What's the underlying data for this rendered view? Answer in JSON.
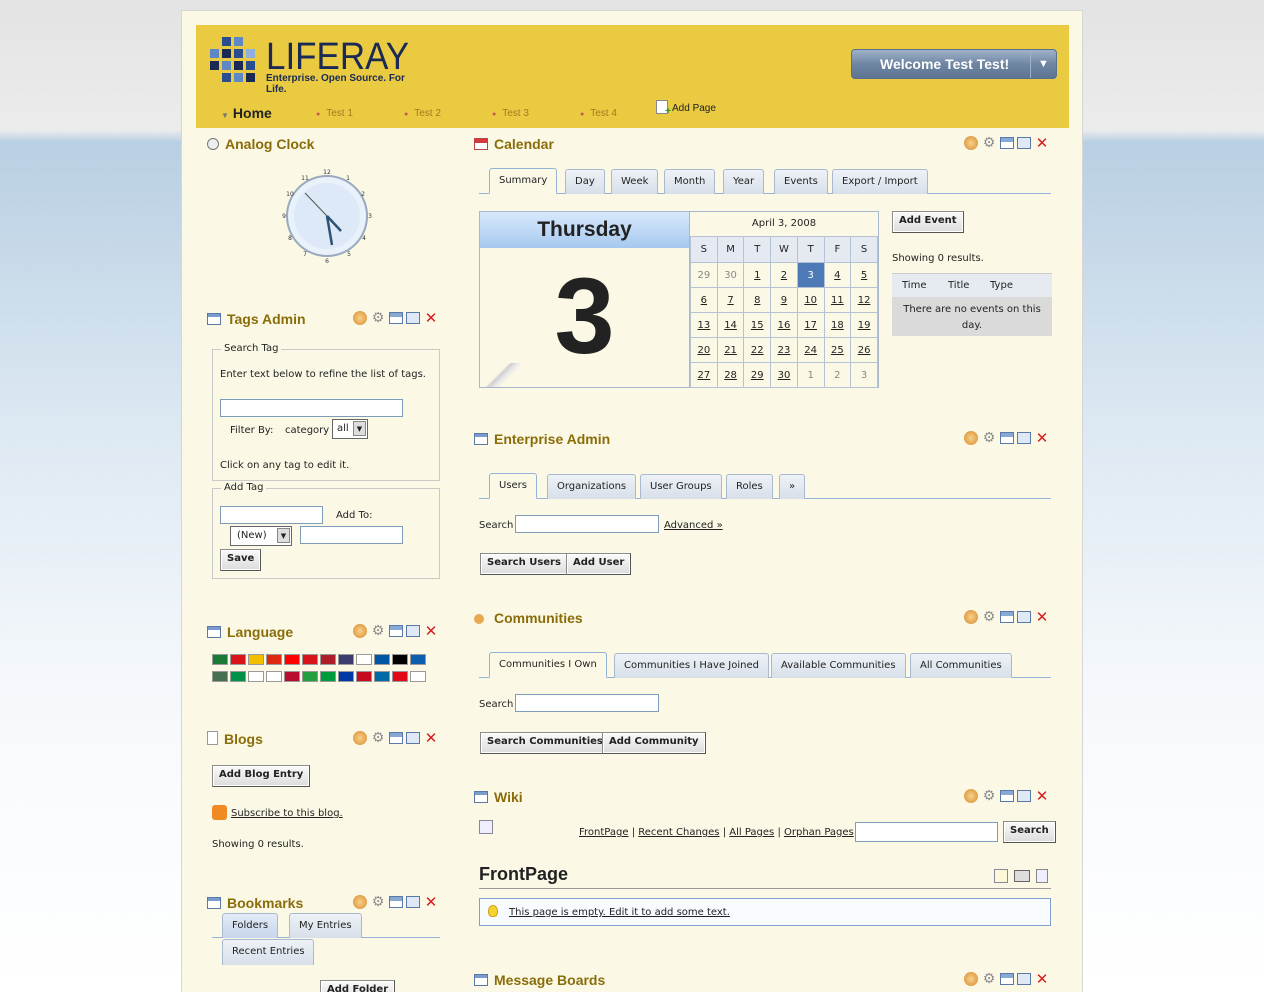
{
  "header": {
    "logo_name": "LIFERAY",
    "logo_tagline": "Enterprise. Open Source. For Life.",
    "welcome": "Welcome Test Test!",
    "welcome_arrow": "▼",
    "brand_color": "#e9ca40"
  },
  "nav": {
    "home": "Home",
    "items": [
      "Test 1",
      "Test 2",
      "Test 3",
      "Test 4"
    ],
    "add_page": "Add Page"
  },
  "analog_clock": {
    "title": "Analog Clock",
    "numbers": [
      "12",
      "1",
      "2",
      "3",
      "4",
      "5",
      "6",
      "7",
      "8",
      "9",
      "10",
      "11"
    ]
  },
  "tags_admin": {
    "title": "Tags Admin",
    "search_legend": "Search Tag",
    "search_hint": "Enter text below to refine the list of tags.",
    "filter_label": "Filter By:",
    "filter_type": "category",
    "filter_value": "all",
    "edit_hint": "Click on any tag to edit it.",
    "add_legend": "Add Tag",
    "add_to_label": "Add To:",
    "new_value": "(New)",
    "save": "Save"
  },
  "language": {
    "title": "Language",
    "flags_row1": [
      "#1a7a35",
      "#d7141a",
      "#f1bf00",
      "#de2910",
      "#fe0000",
      "#d7141a",
      "#ae1c28",
      "#3c3b6e",
      "#ffffff",
      "#0055a4",
      "#000000",
      "#0d5eaf"
    ],
    "flags_row2": [
      "#477050",
      "#009246",
      "#ffffff",
      "#ffffff",
      "#ba0c2f",
      "#239f40",
      "#009c3b",
      "#0039a6",
      "#c60b1e",
      "#006aa7",
      "#e30a17",
      "#ffffff"
    ]
  },
  "blogs": {
    "title": "Blogs",
    "add_entry": "Add Blog Entry",
    "subscribe": "Subscribe to this blog.",
    "showing": "Showing 0 results."
  },
  "bookmarks": {
    "title": "Bookmarks",
    "tabs": [
      "Folders",
      "My Entries",
      "Recent Entries"
    ],
    "add_folder": "Add Folder"
  },
  "calendar": {
    "title": "Calendar",
    "tabs": [
      "Summary",
      "Day",
      "Week",
      "Month",
      "Year",
      "Events",
      "Export / Import"
    ],
    "weekday": "Thursday",
    "day_number": "3",
    "month_label": "April 3, 2008",
    "day_headers": [
      "S",
      "M",
      "T",
      "W",
      "T",
      "F",
      "S"
    ],
    "weeks": [
      [
        "29",
        "30",
        "1",
        "2",
        "3",
        "4",
        "5"
      ],
      [
        "6",
        "7",
        "8",
        "9",
        "10",
        "11",
        "12"
      ],
      [
        "13",
        "14",
        "15",
        "16",
        "17",
        "18",
        "19"
      ],
      [
        "20",
        "21",
        "22",
        "23",
        "24",
        "25",
        "26"
      ],
      [
        "27",
        "28",
        "29",
        "30",
        "1",
        "2",
        "3"
      ]
    ],
    "add_event": "Add Event",
    "showing": "Showing 0 results.",
    "event_headers": [
      "Time",
      "Title",
      "Type"
    ],
    "no_events": "There are no events on this day."
  },
  "enterprise_admin": {
    "title": "Enterprise Admin",
    "tabs": [
      "Users",
      "Organizations",
      "User Groups",
      "Roles",
      "»"
    ],
    "search_label": "Search",
    "advanced": "Advanced »",
    "search_button": "Search Users",
    "add_button": "Add User"
  },
  "communities": {
    "title": "Communities",
    "tabs": [
      "Communities I Own",
      "Communities I Have Joined",
      "Available Communities",
      "All Communities"
    ],
    "search_label": "Search",
    "search_button": "Search Communities",
    "add_button": "Add Community"
  },
  "wiki": {
    "title": "Wiki",
    "links": [
      "FrontPage",
      "Recent Changes",
      "All Pages",
      "Orphan Pages"
    ],
    "separator": "|",
    "search_button": "Search",
    "page_title": "FrontPage",
    "empty_message": "This page is empty. Edit it to add some text."
  },
  "message_boards": {
    "title": "Message Boards"
  }
}
